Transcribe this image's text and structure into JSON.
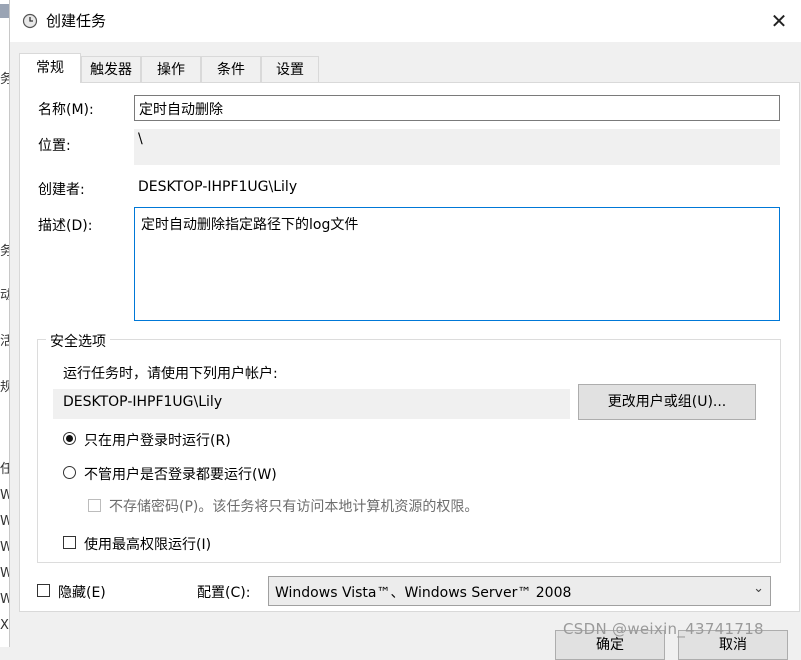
{
  "dialog": {
    "title": "创建任务",
    "close_symbol": "✕"
  },
  "background_strip_chars": [
    "务",
    "务",
    "动",
    "活",
    "规",
    "任",
    "W",
    "W",
    "W",
    "W",
    "W",
    "X",
    "X"
  ],
  "tabs": [
    {
      "label": "常规",
      "active": true
    },
    {
      "label": "触发器",
      "active": false
    },
    {
      "label": "操作",
      "active": false
    },
    {
      "label": "条件",
      "active": false
    },
    {
      "label": "设置",
      "active": false
    }
  ],
  "general": {
    "name_label": "名称(M):",
    "name_value": "定时自动删除",
    "location_label": "位置:",
    "location_value": "\\",
    "author_label": "创建者:",
    "author_value": "DESKTOP-IHPF1UG\\Lily",
    "desc_label": "描述(D):",
    "desc_value": "定时自动删除指定路径下的log文件"
  },
  "security": {
    "group_title": "安全选项",
    "run_as_label": "运行任务时，请使用下列用户帐户:",
    "user_value": "DESKTOP-IHPF1UG\\Lily",
    "change_user_button": "更改用户或组(U)...",
    "radio_logged_on": "只在用户登录时运行(R)",
    "radio_logged_on_selected": true,
    "radio_whether_logged": "不管用户是否登录都要运行(W)",
    "radio_whether_logged_selected": false,
    "no_store_password": "不存储密码(P)。该任务将只有访问本地计算机资源的权限。",
    "no_store_password_checked": false,
    "highest_privileges": "使用最高权限运行(I)",
    "highest_privileges_checked": false
  },
  "bottom": {
    "hidden_label": "隐藏(E)",
    "hidden_checked": false,
    "config_label": "配置(C):",
    "config_value": "Windows Vista™、Windows Server™ 2008",
    "ok_button": "确定",
    "cancel_button": "取消"
  },
  "watermark": "CSDN @weixin_43741718"
}
